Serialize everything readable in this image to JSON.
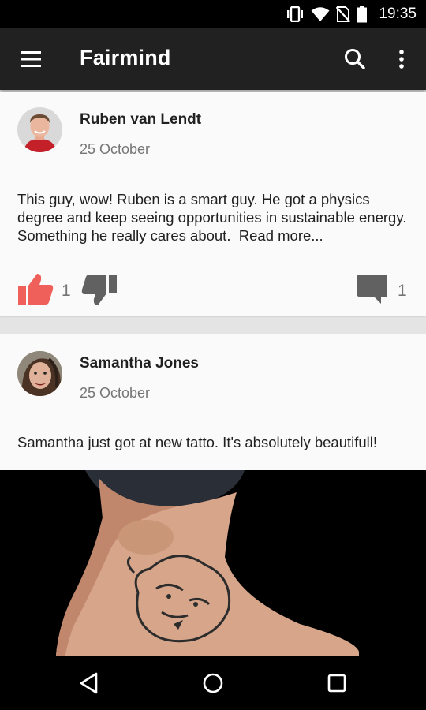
{
  "status_bar": {
    "time": "19:35",
    "icons": [
      "vibrate-icon",
      "wifi-icon",
      "no-sim-icon",
      "battery-icon"
    ]
  },
  "app_bar": {
    "title": "Fairmind",
    "icons": [
      "menu-icon",
      "search-icon",
      "more-vert-icon"
    ]
  },
  "colors": {
    "app_bar": "#212121",
    "like_active": "#f0605a",
    "action_grey": "#616161",
    "card": "#fafafa",
    "feed_bg": "#e4e4e4"
  },
  "posts": [
    {
      "author": "Ruben van Lendt",
      "date": "25 October",
      "text": "This guy, wow! Ruben is a smart guy. He got a physics degree and keep seeing opportunities in sustainable energy. Something he really cares about.",
      "read_more": "Read more...",
      "likes": "1",
      "comments": "1",
      "liked": true
    },
    {
      "author": "Samantha Jones",
      "date": "25 October",
      "text": "Samantha just got at new tatto. It's absolutely beautifull!",
      "image": "photo of foot with tiger tattoo"
    }
  ],
  "nav_bar": {
    "icons": [
      "back-icon",
      "home-icon",
      "recents-icon"
    ]
  }
}
